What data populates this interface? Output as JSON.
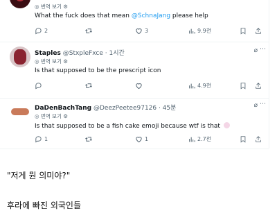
{
  "translate_label": "번역 보기",
  "tweets": [
    {
      "name": "",
      "handle": "",
      "time": "",
      "body_before": "What the fuck does that mean ",
      "mention": "@SchnaJang",
      "body_after": " please help",
      "replies": "2",
      "likes": "3",
      "views": "9.9천"
    },
    {
      "name": "Staples",
      "handle": "@StxpleFxce · 1시간",
      "body": "Is that supposed to be the prescript icon",
      "replies": "",
      "likes": "",
      "views": "4.9천"
    },
    {
      "name": "DaDenBachTang",
      "handle": "@DeezPeetee97126 · 45분",
      "body": "Is that supposed to be a fish cake emoji because wtf is that",
      "replies": "1",
      "likes": "1",
      "views": "2.7천"
    }
  ],
  "caption_1": "\"저게 뭔 의미야?\"",
  "caption_2": "후라에 빠진 외국인들",
  "colors": {
    "link": "#1d9bf0",
    "muted": "#536471",
    "divider": "#eff3f4"
  }
}
